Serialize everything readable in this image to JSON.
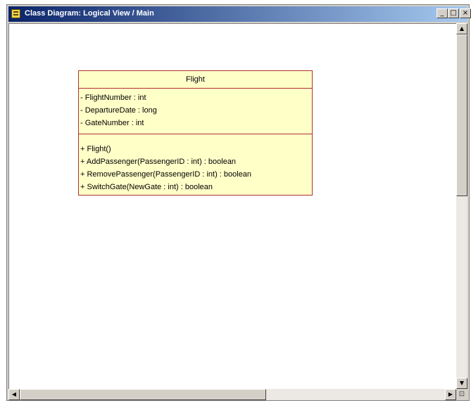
{
  "window": {
    "title": "Class Diagram: Logical View / Main",
    "buttons": {
      "minimize": "_",
      "maximize": "□",
      "close": "×"
    }
  },
  "scrollbars": {
    "up_arrow": "▲",
    "down_arrow": "▼",
    "left_arrow": "◀",
    "right_arrow": "▶",
    "grip": "⊡"
  },
  "uml_class": {
    "name": "Flight",
    "attributes": [
      "- FlightNumber : int",
      "- DepartureDate : long",
      "- GateNumber : int"
    ],
    "operations": [
      "+ Flight()",
      "+ AddPassenger(PassengerID : int) : boolean",
      "+ RemovePassenger(PassengerID : int) : boolean",
      "+ SwitchGate(NewGate : int) : boolean"
    ],
    "fill_color": "#ffffc8",
    "border_color": "#b03030"
  }
}
